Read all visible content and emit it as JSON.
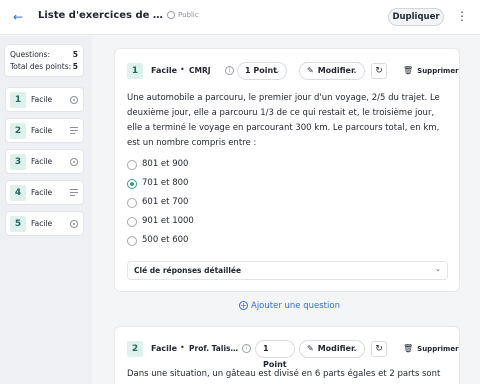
{
  "header": {
    "title": "Liste d'exercices de Représentation",
    "title_visible": "Liste d'exercices de Repré...",
    "visibility": "Public",
    "duplicate_label": "Dupliquer",
    "more_icon": "kebab-icon",
    "back_icon": "arrow-left-icon"
  },
  "sidebar": {
    "questions_label": "Questions:",
    "questions_value": "5",
    "points_label": "Total des points:",
    "points_value": "5",
    "items": [
      {
        "num": "1",
        "label": "Facile",
        "type": "radio-icon"
      },
      {
        "num": "2",
        "label": "Facile",
        "type": "lines-icon"
      },
      {
        "num": "3",
        "label": "Facile",
        "type": "radio-icon"
      },
      {
        "num": "4",
        "label": "Facile",
        "type": "lines-icon"
      },
      {
        "num": "5",
        "label": "Facile",
        "type": "radio-icon"
      }
    ]
  },
  "question1": {
    "num": "1",
    "level": "Facile",
    "source": "CMRJ",
    "points": "1 Point",
    "edit_label": "Modifier",
    "delete_label": "Supprimer",
    "text": "Une automobile a parcouru, le premier jour d'un voyage, 2/5 du trajet. Le deuxième jour, elle a parcouru 1/3 de ce qui restait et, le troisième jour, elle a terminé le voyage en parcourant 300 km. Le parcours total, en km, est un nombre compris entre :",
    "options": [
      "801 et 900",
      "701 et 800",
      "601 et 700",
      "901 et 1000",
      "500 et 600"
    ],
    "selected_index": 1,
    "answer_key_label": "Clé de réponses détaillée"
  },
  "add_question_label": "Ajouter une question",
  "question2": {
    "num": "2",
    "level": "Facile",
    "source": "Prof. Talissa",
    "source_visible": "Prof. Taliss...",
    "points": "1 Point",
    "edit_label": "Modifier",
    "delete_label": "Supprimer",
    "text": "Dans une situation, un gâteau est divisé en 6 parts égales et 2 parts sont"
  },
  "colors": {
    "accent": "#2f6fd6",
    "badge_bg": "#dff1ec",
    "badge_fg": "#1c6b57",
    "selected_radio": "#3aa085"
  }
}
